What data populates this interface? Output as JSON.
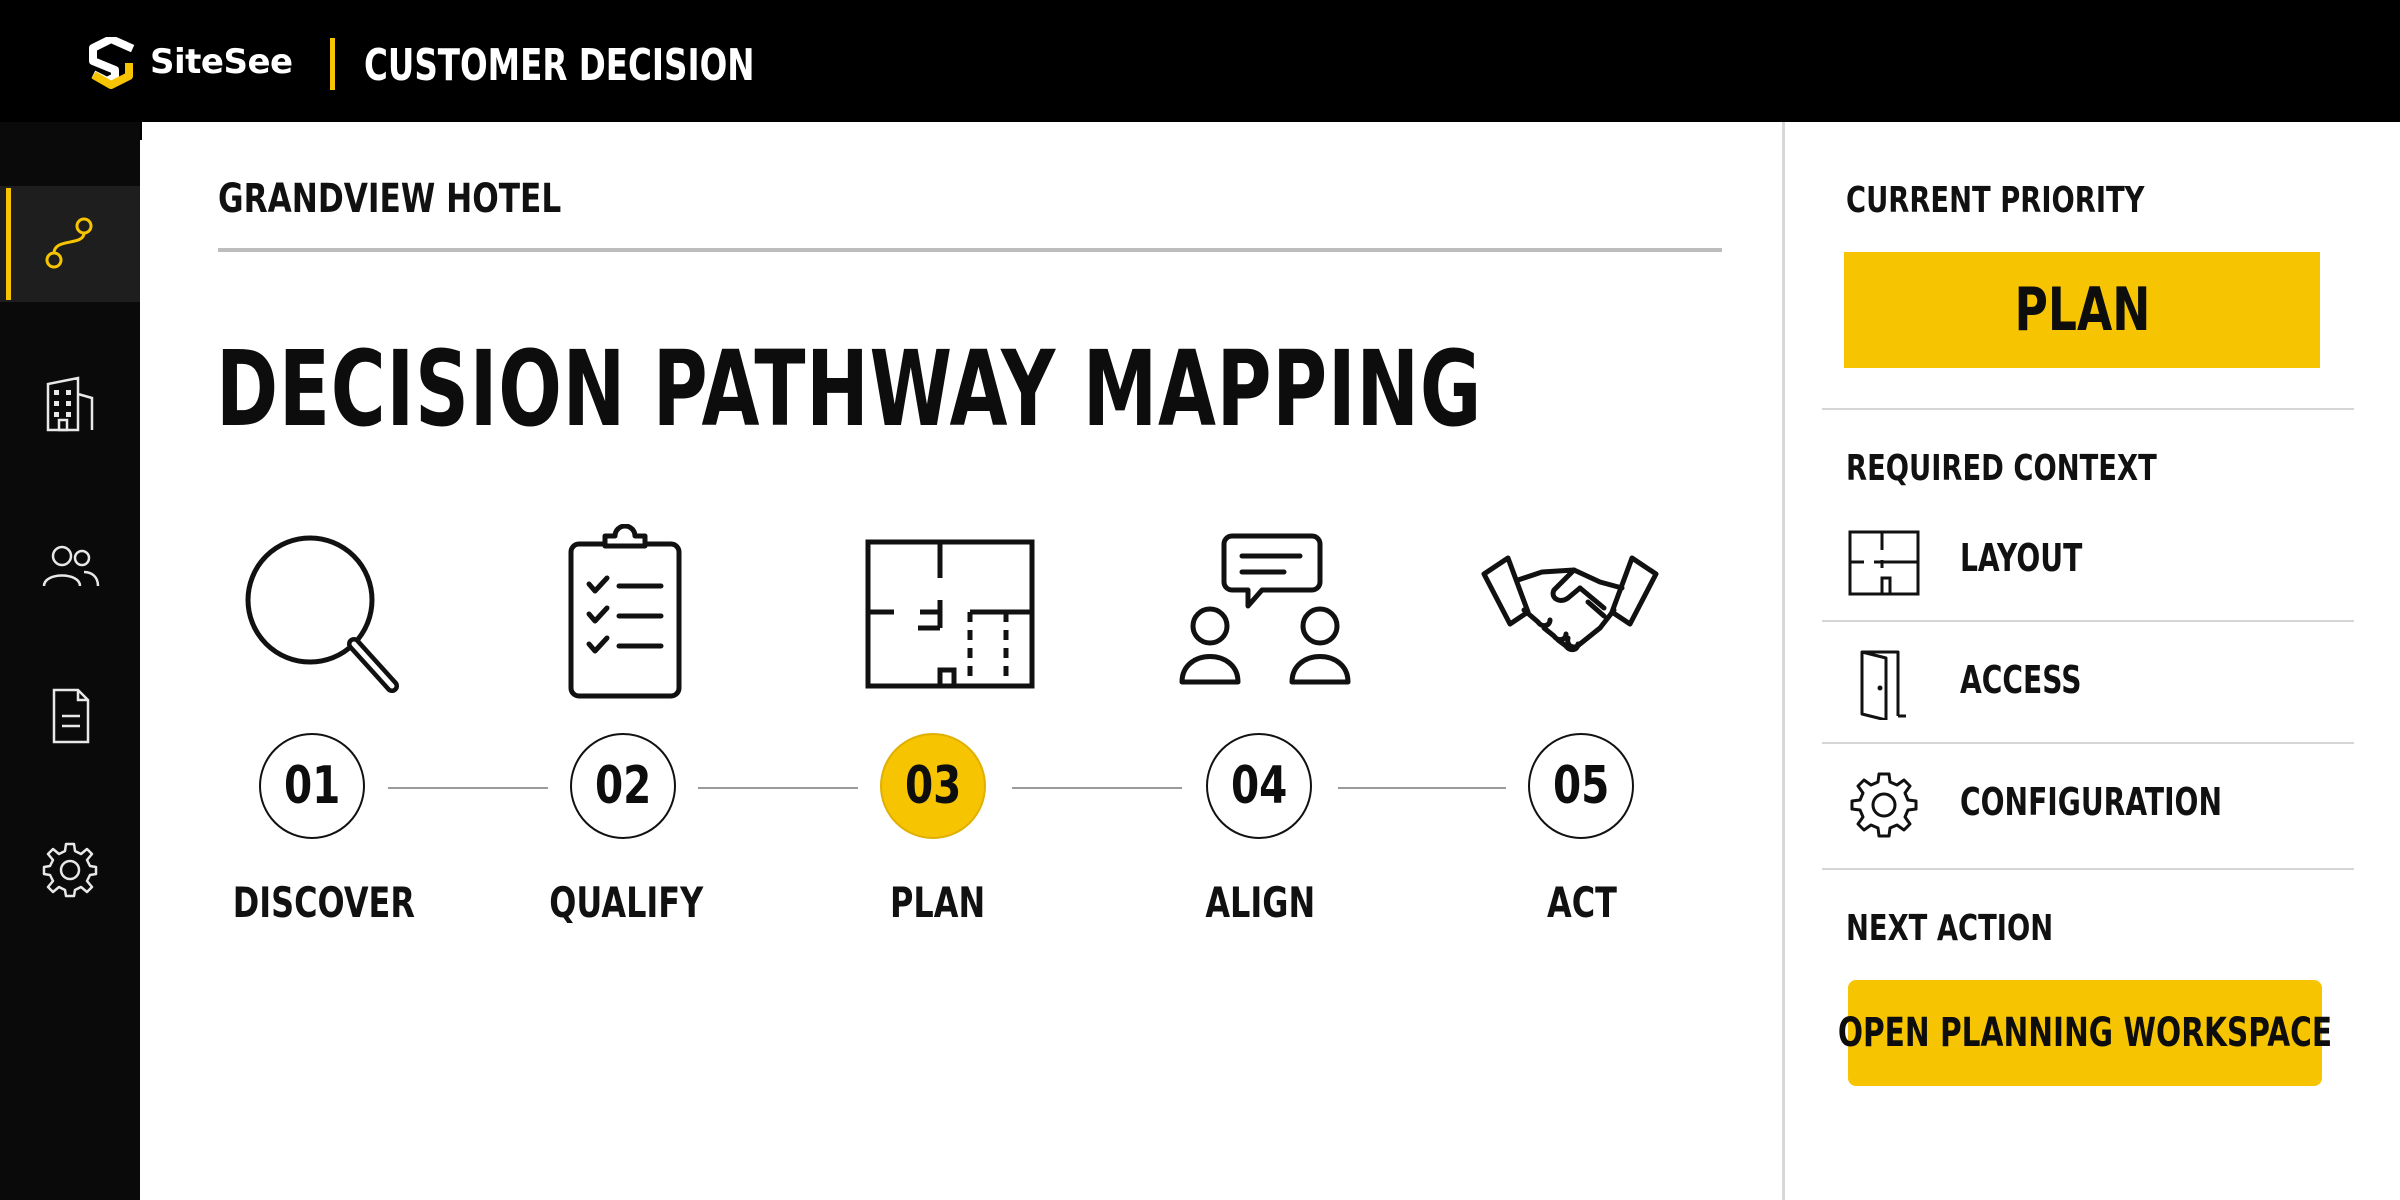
{
  "header": {
    "brand_name": "SiteSee",
    "app_title": "CUSTOMER DECISION"
  },
  "sidebar": {
    "items": [
      {
        "icon": "pathway-icon",
        "active": true
      },
      {
        "icon": "building-icon",
        "active": false
      },
      {
        "icon": "users-icon",
        "active": false
      },
      {
        "icon": "document-icon",
        "active": false
      },
      {
        "icon": "gear-icon",
        "active": false
      }
    ]
  },
  "main": {
    "property_name": "GRANDVIEW HOTEL",
    "title": "DECISION PATHWAY MAPPING",
    "steps": [
      {
        "number": "01",
        "label": "DISCOVER",
        "icon": "magnifier-icon",
        "active": false
      },
      {
        "number": "02",
        "label": "QUALIFY",
        "icon": "clipboard-checklist-icon",
        "active": false
      },
      {
        "number": "03",
        "label": "PLAN",
        "icon": "floorplan-icon",
        "active": true
      },
      {
        "number": "04",
        "label": "ALIGN",
        "icon": "conversation-icon",
        "active": false
      },
      {
        "number": "05",
        "label": "ACT",
        "icon": "handshake-icon",
        "active": false
      }
    ]
  },
  "panel": {
    "current_priority_heading": "CURRENT PRIORITY",
    "current_priority_value": "PLAN",
    "required_context_heading": "REQUIRED CONTEXT",
    "context_items": [
      {
        "label": "LAYOUT",
        "icon": "floorplan-icon"
      },
      {
        "label": "ACCESS",
        "icon": "door-icon"
      },
      {
        "label": "CONFIGURATION",
        "icon": "gear-icon"
      }
    ],
    "next_action_heading": "NEXT ACTION",
    "next_action_label": "OPEN PLANNING WORKSPACE"
  },
  "colors": {
    "accent": "#f6c400",
    "header_bg": "#000000",
    "sidebar_bg": "#0a0a0a"
  }
}
